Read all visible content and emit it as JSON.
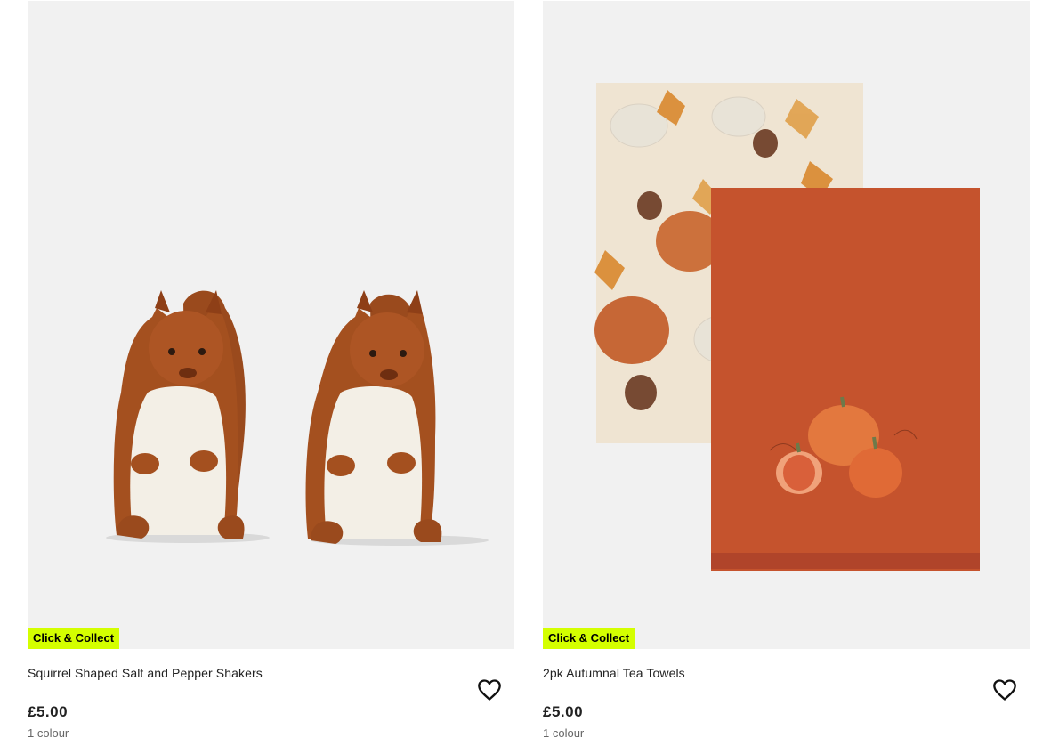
{
  "products": [
    {
      "badge": "Click & Collect",
      "name": "Squirrel Shaped Salt and Pepper Shakers",
      "price": "£5.00",
      "colours": "1 colour",
      "favourite_icon": "heart-outline-icon"
    },
    {
      "badge": "Click & Collect",
      "name": "2pk Autumnal Tea Towels",
      "price": "£5.00",
      "colours": "1 colour",
      "favourite_icon": "heart-outline-icon"
    }
  ],
  "colors": {
    "badge_bg": "#d4ff00",
    "image_bg": "#f1f1f1",
    "squirrel_brown": "#a4501f",
    "towel_orange": "#c5532d"
  }
}
